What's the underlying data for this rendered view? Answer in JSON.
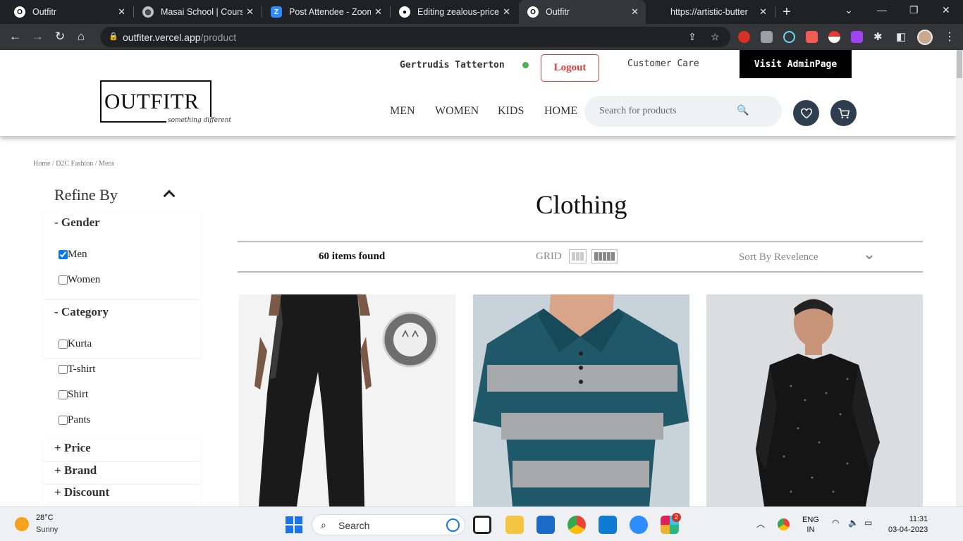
{
  "browser": {
    "tabs": [
      {
        "label": "Outfitr",
        "active": false
      },
      {
        "label": "Masai School | Course",
        "active": false
      },
      {
        "label": "Post Attendee - Zoom",
        "active": false
      },
      {
        "label": "Editing zealous-price-",
        "active": false
      },
      {
        "label": "Outfitr",
        "active": true
      },
      {
        "label": "https://artistic-butter",
        "active": false
      }
    ],
    "url_host": "outfiter.vercel.app",
    "url_path": "/product"
  },
  "header": {
    "logo_text": "OUTFITR",
    "logo_tagline": "something different",
    "username": "Gertrudis Tatterton",
    "logout_label": "Logout",
    "customer_care_label": "Customer Care",
    "admin_label": "Visit AdminPage",
    "nav": [
      "MEN",
      "WOMEN",
      "KIDS",
      "HOME"
    ],
    "search_placeholder": "Search for products"
  },
  "breadcrumb": "Home / D2C Fashion / Mens",
  "sidebar": {
    "title": "Refine By",
    "gender": {
      "heading": "- Gender",
      "options": [
        {
          "label": "Men",
          "checked": true
        },
        {
          "label": "Women",
          "checked": false
        }
      ]
    },
    "category": {
      "heading": "- Category",
      "options": [
        {
          "label": "Kurta",
          "checked": false
        },
        {
          "label": "T-shirt",
          "checked": false
        },
        {
          "label": "Shirt",
          "checked": false
        },
        {
          "label": "Pants",
          "checked": false
        }
      ]
    },
    "collapsed": [
      "+ Price",
      "+ Brand",
      "+ Discount"
    ]
  },
  "main": {
    "title": "Clothing",
    "items_found": "60 items found",
    "grid_label": "GRID",
    "sort_label": "Sort By Revelence",
    "products": [
      {
        "image": "black track pants with anti-static badge"
      },
      {
        "image": "teal and grey striped polo t-shirt"
      },
      {
        "image": "black embellished kurta"
      }
    ]
  },
  "taskbar": {
    "temperature": "28°C",
    "condition": "Sunny",
    "search_label": "Search",
    "lang_line1": "ENG",
    "lang_line2": "IN",
    "time": "11:31",
    "date": "03-04-2023",
    "slack_badge": "2"
  }
}
